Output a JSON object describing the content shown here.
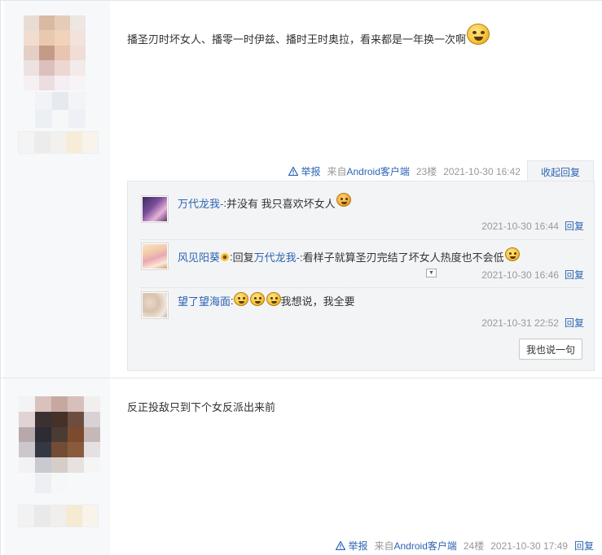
{
  "post1": {
    "text": "播圣刃时坏女人、播零一时伊兹、播时王时奥拉，看来都是一年换一次啊",
    "emoji": "smile-emoji",
    "meta": {
      "report": "举报",
      "client_prefix": "来自",
      "client_link": "Android客户端",
      "floor": "23楼",
      "time": "2021-10-30 16:42",
      "collapse": "收起回复"
    },
    "replies": [
      {
        "user": "万代龙我-",
        "sep": ": ",
        "text": "并没有 我只喜欢坏女人",
        "emoji": "heart-eyes-emoji",
        "time": "2021-10-30 16:44",
        "reply": "回复"
      },
      {
        "user": "风见阳葵",
        "sep": ": ",
        "reply_prefix": "回复 ",
        "reply_to": "万代龙我-",
        "text": " :看样子就算圣刃完结了坏女人热度也不会低",
        "emoji": "smile-emoji",
        "time": "2021-10-30 16:46",
        "reply": "回复"
      },
      {
        "user": "望了望海面",
        "sep": ": ",
        "text": "我想说，我全要",
        "emoji": "smile-emoji",
        "time": "2021-10-31 22:52",
        "reply": "回复"
      }
    ],
    "say_button": "我也说一句"
  },
  "post2": {
    "text": "反正投敌只到下个女反派出来前",
    "meta": {
      "report": "举报",
      "client_prefix": "来自",
      "client_link": "Android客户端",
      "floor": "24楼",
      "time": "2021-10-30 17:49",
      "reply": "回复"
    }
  },
  "colors": {
    "link": "#2d64b3",
    "meta_gray": "#999999",
    "sidebar_bg": "#f7f8fa",
    "lzl_bg": "#f3f4f6"
  }
}
